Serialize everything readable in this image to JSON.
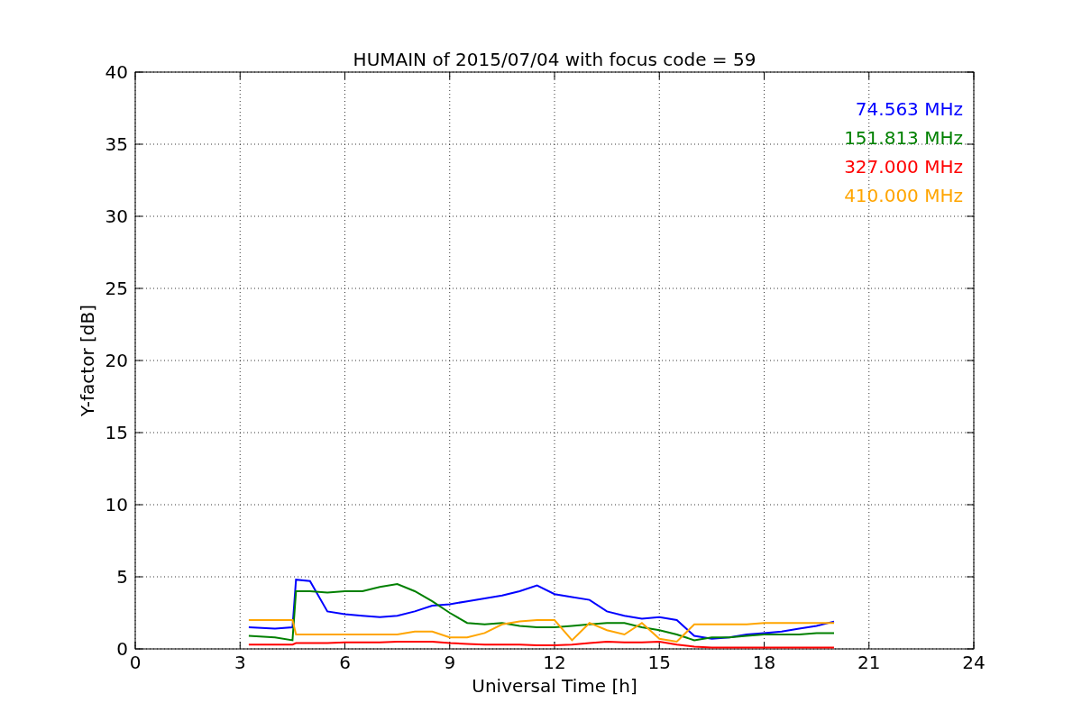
{
  "chart_data": {
    "type": "line",
    "title": "HUMAIN of 2015/07/04 with focus code = 59",
    "xlabel": "Universal Time [h]",
    "ylabel": "Y-factor [dB]",
    "x": [
      3.25,
      4,
      4.5,
      4.6,
      5,
      5.5,
      6,
      6.5,
      7,
      7.5,
      8,
      8.5,
      9,
      9.5,
      10,
      10.5,
      11,
      11.5,
      12,
      12.5,
      13,
      13.5,
      14,
      14.5,
      15,
      15.5,
      16,
      16.5,
      17,
      17.5,
      18,
      18.5,
      19,
      19.5,
      20
    ],
    "series": [
      {
        "name": "74.563 MHz",
        "color": "#0000ff",
        "values": [
          1.5,
          1.4,
          1.5,
          4.8,
          4.7,
          2.6,
          2.4,
          2.3,
          2.2,
          2.3,
          2.6,
          3.0,
          3.1,
          3.3,
          3.5,
          3.7,
          4.0,
          4.4,
          3.8,
          3.6,
          3.4,
          2.6,
          2.3,
          2.1,
          2.2,
          2.0,
          0.9,
          0.7,
          0.8,
          1.0,
          1.1,
          1.2,
          1.4,
          1.6,
          1.9
        ]
      },
      {
        "name": "151.813 MHz",
        "color": "#008000",
        "values": [
          0.9,
          0.8,
          0.6,
          4.0,
          4.0,
          3.9,
          4.0,
          4.0,
          4.3,
          4.5,
          4.0,
          3.3,
          2.5,
          1.8,
          1.7,
          1.8,
          1.6,
          1.5,
          1.5,
          1.6,
          1.7,
          1.8,
          1.8,
          1.5,
          1.3,
          1.0,
          0.6,
          0.8,
          0.8,
          0.9,
          1.0,
          1.0,
          1.0,
          1.1,
          1.1
        ]
      },
      {
        "name": "327.000 MHz",
        "color": "#ff0000",
        "values": [
          0.3,
          0.3,
          0.3,
          0.4,
          0.4,
          0.4,
          0.45,
          0.45,
          0.45,
          0.5,
          0.5,
          0.5,
          0.4,
          0.35,
          0.3,
          0.3,
          0.3,
          0.25,
          0.25,
          0.3,
          0.4,
          0.5,
          0.45,
          0.45,
          0.5,
          0.3,
          0.15,
          0.1,
          0.1,
          0.1,
          0.1,
          0.1,
          0.1,
          0.1,
          0.1
        ]
      },
      {
        "name": "410.000 MHz",
        "color": "#ffa500",
        "values": [
          2.0,
          2.0,
          2.0,
          1.0,
          1.0,
          1.0,
          1.0,
          1.0,
          1.0,
          1.0,
          1.2,
          1.2,
          0.8,
          0.8,
          1.1,
          1.7,
          1.9,
          2.0,
          2.0,
          0.6,
          1.8,
          1.3,
          1.0,
          1.8,
          0.7,
          0.5,
          1.7,
          1.7,
          1.7,
          1.7,
          1.8,
          1.8,
          1.8,
          1.8,
          1.8
        ]
      }
    ],
    "xlim": [
      0,
      24
    ],
    "ylim": [
      0,
      40
    ],
    "xticks": [
      0,
      3,
      6,
      9,
      12,
      15,
      18,
      21,
      24
    ],
    "yticks": [
      0,
      5,
      10,
      15,
      20,
      25,
      30,
      35,
      40
    ],
    "grid": true
  }
}
